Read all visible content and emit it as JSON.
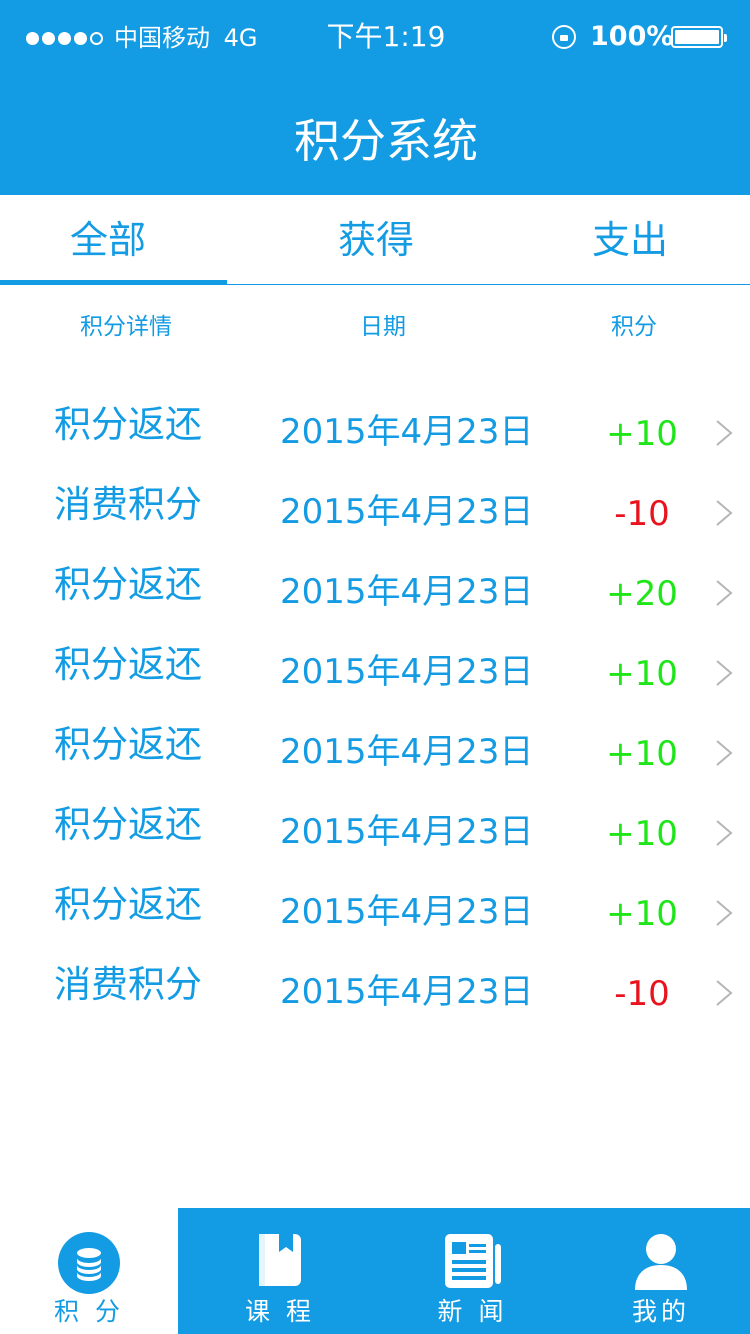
{
  "status_bar": {
    "carrier": "中国移动",
    "network": "4G",
    "time": "下午1:19",
    "battery": "100%"
  },
  "header": {
    "title": "积分系统"
  },
  "tabs": [
    {
      "label": "全部",
      "active": true
    },
    {
      "label": "获得",
      "active": false
    },
    {
      "label": "支出",
      "active": false
    }
  ],
  "columns": {
    "detail": "积分详情",
    "date": "日期",
    "points": "积分"
  },
  "records": [
    {
      "title": "积分返还",
      "date": "2015年4月23日",
      "points": "+10",
      "type": "gain"
    },
    {
      "title": "消费积分",
      "date": "2015年4月23日",
      "points": "-10",
      "type": "spend"
    },
    {
      "title": "积分返还",
      "date": "2015年4月23日",
      "points": "+20",
      "type": "gain"
    },
    {
      "title": "积分返还",
      "date": "2015年4月23日",
      "points": "+10",
      "type": "gain"
    },
    {
      "title": "积分返还",
      "date": "2015年4月23日",
      "points": "+10",
      "type": "gain"
    },
    {
      "title": "积分返还",
      "date": "2015年4月23日",
      "points": "+10",
      "type": "gain"
    },
    {
      "title": "积分返还",
      "date": "2015年4月23日",
      "points": "+10",
      "type": "gain"
    },
    {
      "title": "消费积分",
      "date": "2015年4月23日",
      "points": "-10",
      "type": "spend"
    }
  ],
  "bottom_nav": [
    {
      "label": "积 分",
      "icon": "coin-stack-icon",
      "active": true
    },
    {
      "label": "课 程",
      "icon": "book-icon",
      "active": false
    },
    {
      "label": "新 闻",
      "icon": "newspaper-icon",
      "active": false
    },
    {
      "label": "我的",
      "icon": "user-icon",
      "active": false
    }
  ],
  "colors": {
    "primary": "#139be3",
    "gain": "#1ee619",
    "spend": "#e8131d",
    "chevron": "#b5b5b5"
  }
}
